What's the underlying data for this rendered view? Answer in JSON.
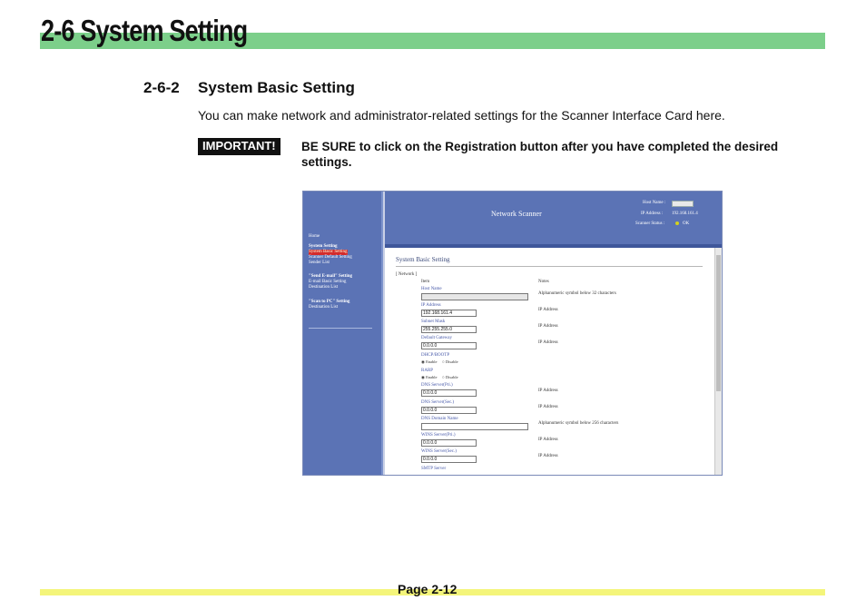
{
  "header": {
    "chapter_title": "2-6 System Setting"
  },
  "section": {
    "number": "2-6-2",
    "title": "System Basic Setting"
  },
  "intro": "You can make network and administrator-related settings for the Scanner Interface Card here.",
  "important": {
    "badge": "IMPORTANT!",
    "text": "BE SURE to click on the Registration button after you have completed the desired settings."
  },
  "screenshot": {
    "sidebar": {
      "home": "Home",
      "system_setting": "System Setting",
      "items1": [
        "System Basic Setting",
        "Scanner Default Setting",
        "Sender List"
      ],
      "send_email": "\"Send E-mail\" Setting",
      "items2": [
        "E-mail Basic Setting",
        "Destination List"
      ],
      "scan_to_pc": "\"Scan to PC\" Setting",
      "items3": [
        "Destination List"
      ]
    },
    "topbar": {
      "title": "Network Scanner",
      "host_name_label": "Host Name :",
      "ip_address_label": "IP Address :",
      "ip_address_value": "192.168.161.4",
      "scanner_status_label": "Scanner Status :",
      "scanner_status_value": "OK"
    },
    "form": {
      "title": "System Basic Setting",
      "group": "[ Network ]",
      "col_item": "Item",
      "col_notes": "Notes",
      "host_name_label": "Host Name",
      "host_name_note": "Alphanumeric symbol below 32 characters",
      "ip_address_label": "IP Address",
      "ip_address_value": "192.168.161.4",
      "ip_address_note": "IP Address",
      "subnet_mask_label": "Subnet Mask",
      "subnet_mask_value": "255.255.255.0",
      "subnet_mask_note": "IP Address",
      "default_gateway_label": "Default Gateway",
      "default_gateway_value": "0.0.0.0",
      "default_gateway_note": "IP Address",
      "dhcp_label": "DHCP/BOOTP",
      "dhcp_enable": "Enable",
      "dhcp_disable": "Disable",
      "rarp_label": "RARP",
      "rarp_enable": "Enable",
      "rarp_disable": "Disable",
      "dns_pri_label": "DNS Server(Pri.)",
      "dns_pri_value": "0.0.0.0",
      "dns_pri_note": "IP Address",
      "dns_sec_label": "DNS Server(Sec.)",
      "dns_sec_value": "0.0.0.0",
      "dns_sec_note": "IP Address",
      "dns_domain_label": "DNS Domain Name",
      "dns_domain_note": "Alphanumeric symbol below 256 characters",
      "wins_pri_label": "WINS Server(Pri.)",
      "wins_pri_value": "0.0.0.0",
      "wins_pri_note": "IP Address",
      "wins_sec_label": "WINS Server(Sec.)",
      "wins_sec_value": "0.0.0.0",
      "wins_sec_note": "IP Address",
      "smtp_label": "SMTP Server"
    }
  },
  "footer": {
    "page": "Page 2-12"
  }
}
